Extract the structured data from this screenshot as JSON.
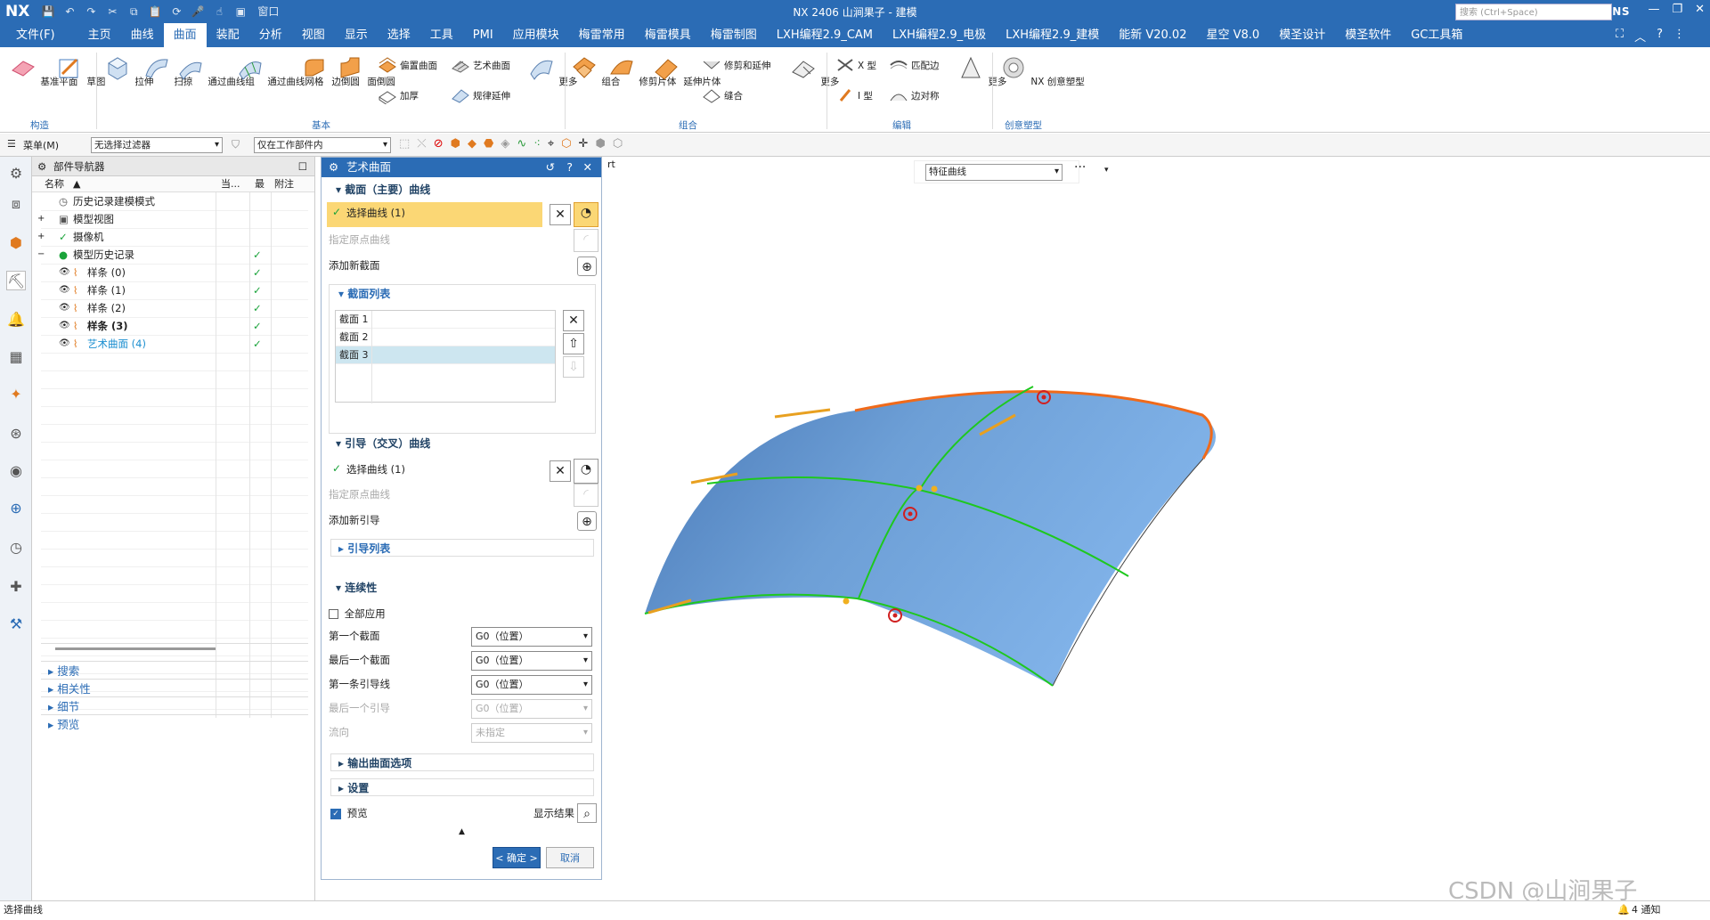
{
  "titlebar": {
    "logo": "NX",
    "title": "NX 2406 山涧果子 - 建模",
    "brand": "SIEMENS",
    "window_menu": "窗口"
  },
  "menubar": {
    "items": [
      "文件(F)",
      "主页",
      "曲线",
      "曲面",
      "装配",
      "分析",
      "视图",
      "显示",
      "选择",
      "工具",
      "PMI",
      "应用模块",
      "梅雷常用",
      "梅雷模具",
      "梅雷制图",
      "LXH编程2.9_CAM",
      "LXH编程2.9_电极",
      "LXH编程2.9_建模",
      "能新 V20.02",
      "星空 V8.0",
      "模圣设计",
      "模圣软件",
      "GC工具箱"
    ],
    "active_index": 3,
    "search_placeholder": "搜索 (Ctrl+Space)"
  },
  "ribbon": {
    "construct": {
      "label": "构造",
      "buttons": [
        "基准平面",
        "草图"
      ]
    },
    "basic": {
      "label": "基本",
      "big": [
        "拉伸",
        "扫掠",
        "通过曲线组",
        "通过曲线网格",
        "边倒圆",
        "面倒圆"
      ],
      "small": [
        "偏置曲面",
        "艺术曲面",
        "加厚",
        "规律延伸"
      ],
      "more": "更多"
    },
    "combine": {
      "label": "组合",
      "big": [
        "组合",
        "修剪片体",
        "延伸片体"
      ],
      "small": [
        "修剪和延伸",
        "缝合"
      ],
      "more": "更多"
    },
    "edit": {
      "label": "编辑",
      "small": [
        "X 型",
        "I 型",
        "匹配边",
        "边对称"
      ],
      "more": "更多"
    },
    "creative": {
      "label": "创意塑型",
      "button": "NX 创意塑型"
    }
  },
  "toolbar2": {
    "menu_label": "菜单(M)",
    "filter": "无选择过滤器",
    "scope": "仅在工作部件内"
  },
  "navigator": {
    "title": "部件导航器",
    "columns": [
      "名称",
      "当...",
      "最",
      "附注"
    ],
    "rows": [
      {
        "label": "历史记录建模模式",
        "indent": 0,
        "check": false
      },
      {
        "label": "模型视图",
        "indent": 0,
        "check": false
      },
      {
        "label": "摄像机",
        "indent": 0,
        "check": false
      },
      {
        "label": "模型历史记录",
        "indent": 0,
        "check": true
      },
      {
        "label": "样条 (0)",
        "indent": 1,
        "check": true
      },
      {
        "label": "样条 (1)",
        "indent": 1,
        "check": true
      },
      {
        "label": "样条 (2)",
        "indent": 1,
        "check": true
      },
      {
        "label": "样条 (3)",
        "indent": 1,
        "check": true,
        "bold": true
      },
      {
        "label": "艺术曲面 (4)",
        "indent": 1,
        "check": true,
        "color": "#1c8fd0"
      }
    ],
    "sections": [
      "搜索",
      "相关性",
      "细节",
      "预览"
    ]
  },
  "dialog": {
    "title": "艺术曲面",
    "section_curves": "截面（主要）曲线",
    "select_curve_1": "选择曲线 (1)",
    "origin_curve": "指定原点曲线",
    "add_section": "添加新截面",
    "section_list_title": "截面列表",
    "section_list": [
      "截面 1",
      "截面 2",
      "截面 3"
    ],
    "guide_curves": "引导（交叉）曲线",
    "select_curve_2": "选择曲线 (1)",
    "origin_curve_2": "指定原点曲线",
    "add_guide": "添加新引导",
    "guide_list_title": "引导列表",
    "continuity": "连续性",
    "apply_all": "全部应用",
    "first_section": "第一个截面",
    "last_section": "最后一个截面",
    "first_guide": "第一条引导线",
    "last_guide": "最后一个引导",
    "flow": "流向",
    "g0": "G0（位置）",
    "unspecified": "未指定",
    "output_options": "输出曲面选项",
    "settings": "设置",
    "preview": "预览",
    "show_result": "显示结果",
    "ok": "< 确定 >",
    "cancel": "取消"
  },
  "viewport": {
    "filter_combo": "特征曲线",
    "more": "···",
    "tab_fragment": "rt"
  },
  "status": {
    "prompt": "选择曲线",
    "notifications": "4 通知",
    "watermark": "CSDN @山涧果子"
  },
  "colors": {
    "accent": "#2b6cb5",
    "surface": "#6d9fd6",
    "guide": "#1ec81e",
    "edge": "#f06a1a",
    "highlight": "#fbd775"
  }
}
